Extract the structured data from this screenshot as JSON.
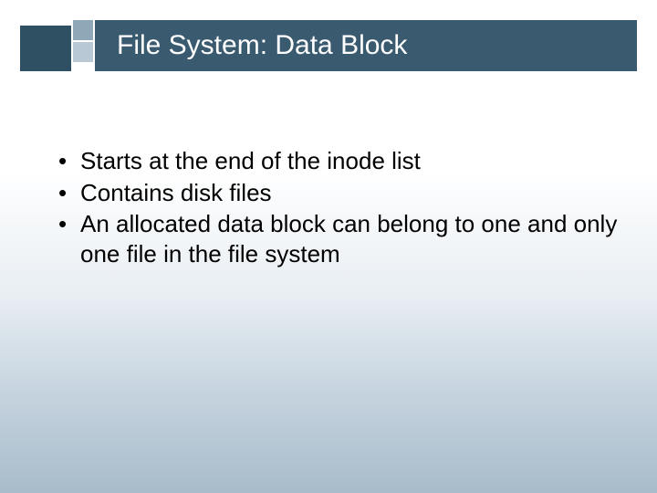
{
  "title": "File System: Data Block",
  "bullets": [
    "Starts at the end of the inode list",
    "Contains disk files",
    "An allocated data block can belong to one and only one file in the file system"
  ]
}
